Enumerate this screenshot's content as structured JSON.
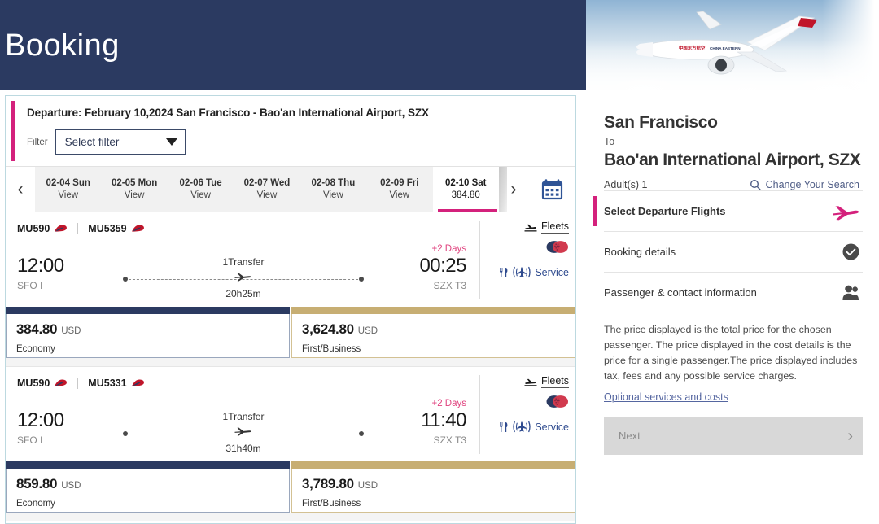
{
  "header": {
    "title": "Booking",
    "airline_photo_alt": "china-eastern-aircraft"
  },
  "search_panel": {
    "departure_line": "Departure: February 10,2024 San Francisco - Bao'an International Airport, SZX",
    "filter_label": "Filter",
    "filter_value": "Select filter",
    "prev_label": "‹",
    "next_label": "›",
    "calendar_icon": "calendar-icon",
    "dates": [
      {
        "date": "02-04 Sun",
        "value": "View",
        "active": false
      },
      {
        "date": "02-05 Mon",
        "value": "View",
        "active": false
      },
      {
        "date": "02-06 Tue",
        "value": "View",
        "active": false
      },
      {
        "date": "02-07 Wed",
        "value": "View",
        "active": false
      },
      {
        "date": "02-08 Thu",
        "value": "View",
        "active": false
      },
      {
        "date": "02-09 Fri",
        "value": "View",
        "active": false
      },
      {
        "date": "02-10 Sat",
        "value": "384.80",
        "active": true
      }
    ]
  },
  "flights": [
    {
      "flight_numbers": [
        "MU590",
        "MU5359"
      ],
      "depart_time": "12:00",
      "depart_port": "SFO I",
      "arrive_time": "00:25",
      "arrive_port": "SZX T3",
      "plus_days": "+2 Days",
      "transfers": "1Transfer",
      "duration": "20h25m",
      "fleets_label": "Fleets",
      "service_label": "Service",
      "fares": [
        {
          "amount": "384.80",
          "currency": "USD",
          "cabin": "Economy",
          "cabin_type": "economy"
        },
        {
          "amount": "3,624.80",
          "currency": "USD",
          "cabin": "First/Business",
          "cabin_type": "business"
        }
      ]
    },
    {
      "flight_numbers": [
        "MU590",
        "MU5331"
      ],
      "depart_time": "12:00",
      "depart_port": "SFO I",
      "arrive_time": "11:40",
      "arrive_port": "SZX T3",
      "plus_days": "+2 Days",
      "transfers": "1Transfer",
      "duration": "31h40m",
      "fleets_label": "Fleets",
      "service_label": "Service",
      "fares": [
        {
          "amount": "859.80",
          "currency": "USD",
          "cabin": "Economy",
          "cabin_type": "economy"
        },
        {
          "amount": "3,789.80",
          "currency": "USD",
          "cabin": "First/Business",
          "cabin_type": "business"
        }
      ]
    }
  ],
  "sidebar": {
    "origin_city": "San Francisco",
    "to_label": "To",
    "destination": "Bao'an International Airport, SZX",
    "adults": "Adult(s) 1",
    "change_search": "Change Your Search",
    "steps": [
      {
        "label": "Select Departure Flights",
        "icon": "plane-icon",
        "active": true
      },
      {
        "label": "Booking details",
        "icon": "check-circle-icon",
        "active": false
      },
      {
        "label": "Passenger & contact information",
        "icon": "person-icon",
        "active": false
      }
    ],
    "price_note": "The price displayed is the total price for the chosen passenger. The price displayed in the cost details is the price for a single passenger.The price displayed includes tax, fees and any possible service charges.",
    "optional_link": "Optional services and costs",
    "next_button": "Next",
    "next_chevron": "›"
  },
  "colors": {
    "header_navy": "#2b3a61",
    "accent_pink": "#d4217c",
    "economy_navy": "#2b3a61",
    "business_gold": "#c7ae73",
    "link_blue": "#5566a0",
    "plus_days_pink": "#e0437f"
  }
}
